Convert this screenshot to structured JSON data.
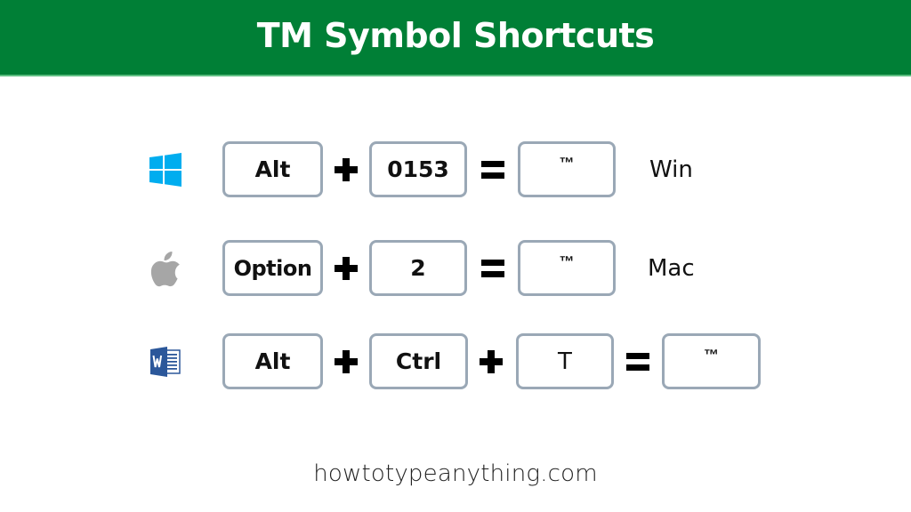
{
  "header": {
    "title": "TM Symbol Shortcuts",
    "background_color": "#007f36"
  },
  "rows": [
    {
      "platform": "Win",
      "icon": "windows-logo-icon",
      "keys": [
        "Alt",
        "0153"
      ],
      "operators": [
        "+",
        "="
      ],
      "result": "™"
    },
    {
      "platform": "Mac",
      "icon": "apple-logo-icon",
      "keys": [
        "Option",
        "2"
      ],
      "operators": [
        "+",
        "="
      ],
      "result": "™"
    },
    {
      "platform": "",
      "icon": "word-logo-icon",
      "keys": [
        "Alt",
        "Ctrl",
        "T"
      ],
      "operators": [
        "+",
        "+",
        "="
      ],
      "result": "™"
    }
  ],
  "colors": {
    "key_border": "#9aa8b6",
    "windows_blue": "#00adef",
    "apple_gray": "#a6a6a6",
    "word_blue": "#2b579a"
  },
  "footer": {
    "site": "howtotypeanything.com"
  }
}
